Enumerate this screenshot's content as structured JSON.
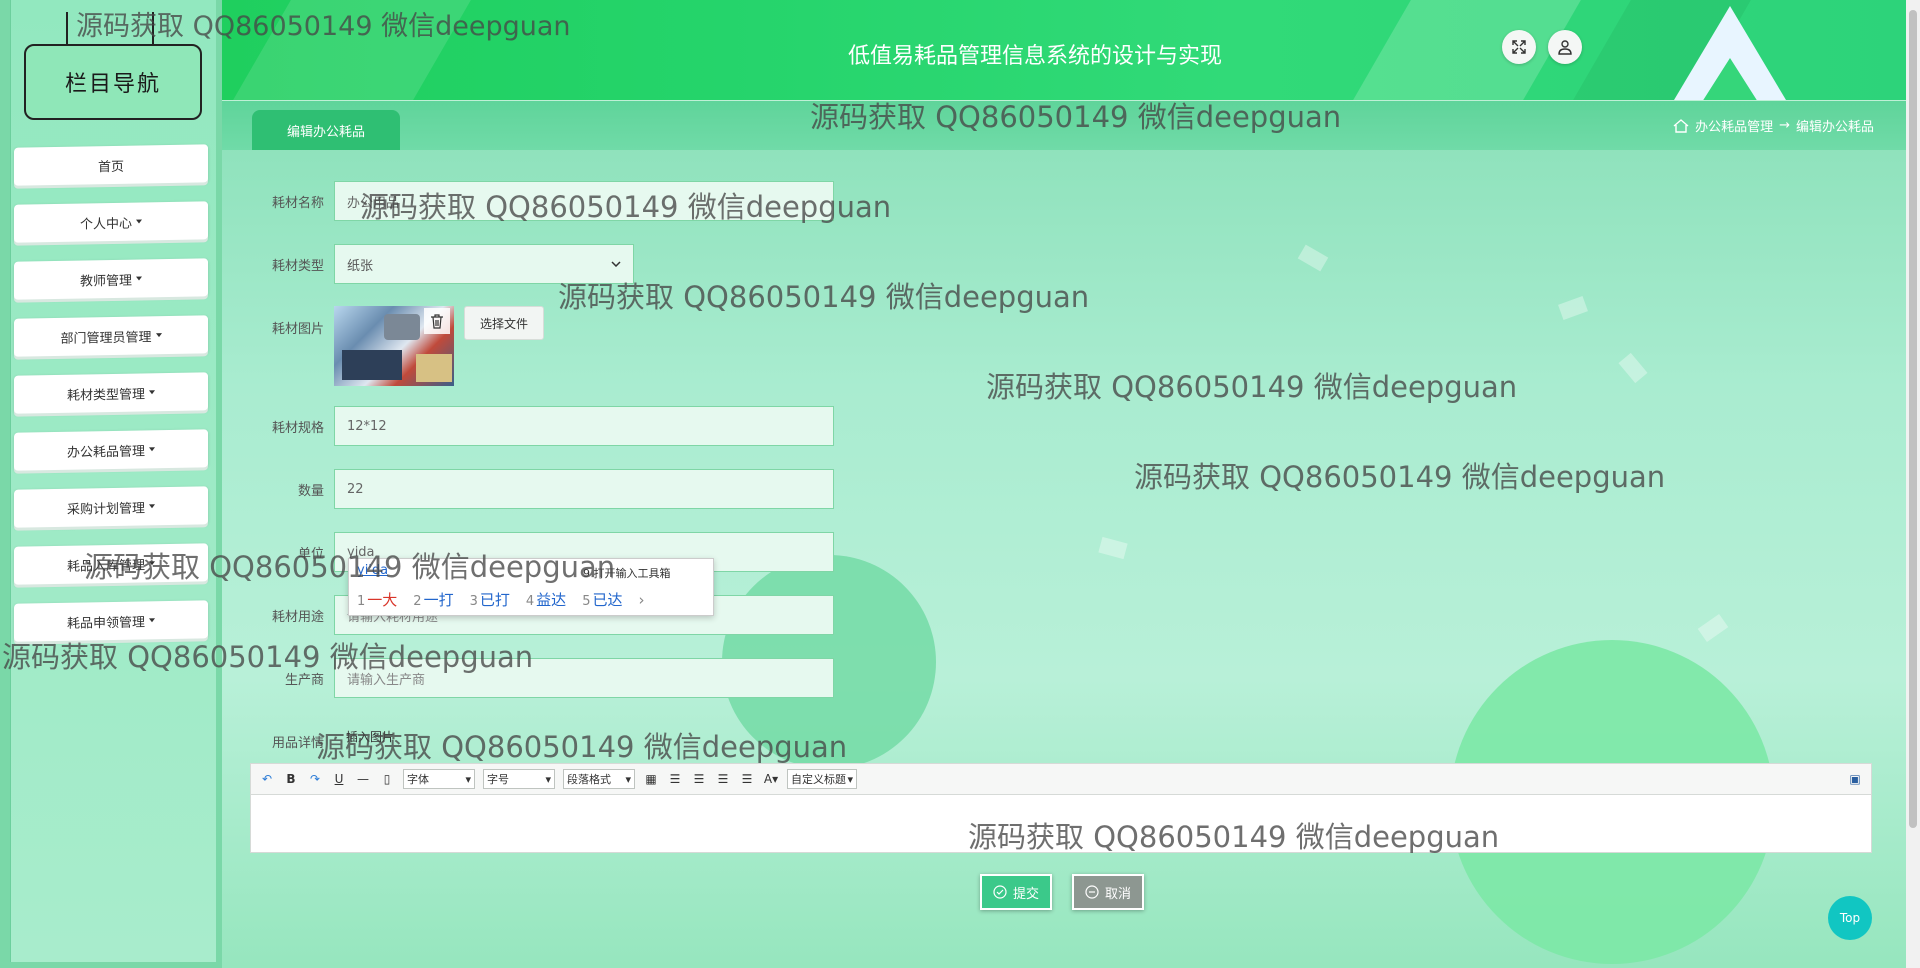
{
  "app_title": "低值易耗品管理信息系统的设计与实现",
  "sidebar": {
    "title": "栏目导航",
    "items": [
      {
        "label": "首页",
        "dropdown": false
      },
      {
        "label": "个人中心",
        "dropdown": true
      },
      {
        "label": "教师管理",
        "dropdown": true
      },
      {
        "label": "部门管理员管理",
        "dropdown": true
      },
      {
        "label": "耗材类型管理",
        "dropdown": true
      },
      {
        "label": "办公耗品管理",
        "dropdown": true
      },
      {
        "label": "采购计划管理",
        "dropdown": true
      },
      {
        "label": "耗品入库管理",
        "dropdown": true
      },
      {
        "label": "耗品申领管理",
        "dropdown": true
      }
    ]
  },
  "tab": {
    "label": "编辑办公耗品"
  },
  "breadcrumb": {
    "items": [
      "办公耗品管理",
      "→",
      "编辑办公耗品"
    ]
  },
  "form": {
    "name": {
      "label": "耗材名称",
      "value": "办公用品"
    },
    "type": {
      "label": "耗材类型",
      "value": "纸张"
    },
    "image": {
      "label": "耗材图片",
      "file_button": "选择文件"
    },
    "spec": {
      "label": "耗材规格",
      "value": "12*12"
    },
    "quantity": {
      "label": "数量",
      "value": "22"
    },
    "unit": {
      "label": "单位",
      "value": "yida"
    },
    "usage": {
      "label": "耗材用途",
      "placeholder": "请输入耗材用途"
    },
    "producer": {
      "label": "生产商",
      "placeholder": "请输入生产商"
    },
    "detail": {
      "label": "用品详情",
      "tab": "插入图片"
    }
  },
  "ime": {
    "composition": "yi'da",
    "tool_hint": "打开输入工具箱",
    "candidates": [
      {
        "num": "1",
        "text": "一大"
      },
      {
        "num": "2",
        "text": "一打"
      },
      {
        "num": "3",
        "text": "已打"
      },
      {
        "num": "4",
        "text": "益达"
      },
      {
        "num": "5",
        "text": "已达"
      }
    ]
  },
  "editor_toolbar": {
    "font": "字体",
    "size": "字号",
    "paragraph": "段落格式",
    "custom_title": "自定义标题"
  },
  "buttons": {
    "submit": "提交",
    "cancel": "取消",
    "top": "Top"
  },
  "watermark": "源码获取 QQ86050149 微信deepguan",
  "colors": {
    "accent": "#2fbf73",
    "header": "#25d46b",
    "top_button": "#11c6c2"
  }
}
